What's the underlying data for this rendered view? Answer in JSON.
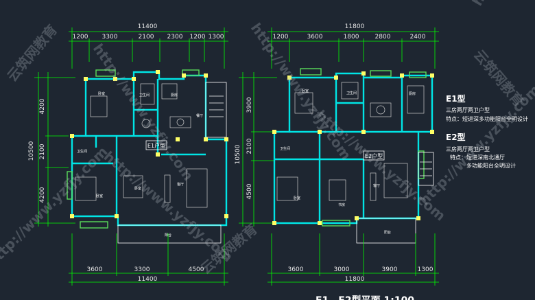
{
  "plan_e1": {
    "total_top": "11400",
    "top_segments": [
      "1200",
      "3300",
      "2100",
      "2300",
      "1200",
      "1300"
    ],
    "total_bottom": "11400",
    "bottom_segments": [
      "3600",
      "3300",
      "4500"
    ],
    "total_left": "10500",
    "left_segments": [
      "4200",
      "2100",
      "4200"
    ],
    "tag": "E1户型",
    "rooms": [
      "卧室",
      "卫生间",
      "厨房",
      "餐厅",
      "卫生间",
      "卧室",
      "卧室",
      "客厅",
      "阳台"
    ]
  },
  "plan_e2": {
    "total_top": "11800",
    "top_segments": [
      "1200",
      "3600",
      "1800",
      "2800",
      "2400"
    ],
    "total_bottom": "11800",
    "bottom_segments": [
      "3600",
      "3000",
      "3900",
      "1300"
    ],
    "total_left": "10500",
    "left_segments": [
      "3900",
      "2100",
      "4500"
    ],
    "tag": "E2户型",
    "rooms": [
      "卧室",
      "卫生间",
      "厨房",
      "卫生间",
      "卧室",
      "书房",
      "客厅",
      "阳台"
    ]
  },
  "legend": {
    "e1_title": "E1型",
    "e1_desc": "三房两厅两卫户型",
    "e1_feature": "特点：短进深多功能阳台全明设计",
    "e2_title": "E2型",
    "e2_desc": "三房两厅两卫户型",
    "e2_feature_1": "特点：短进深南北通厅",
    "e2_feature_2": "多功能阳台全明设计"
  },
  "footer_title": "E1、E2型平面 1:100",
  "watermarks": [
    "http://www.yzfjy.com",
    "云筑网教育"
  ],
  "colors": {
    "background": "#1e2631",
    "dimension": "#00ff00",
    "wall": "#00e5e5",
    "column": "#ffff66",
    "window": "#5adc5a",
    "furniture": "#cccccc"
  }
}
